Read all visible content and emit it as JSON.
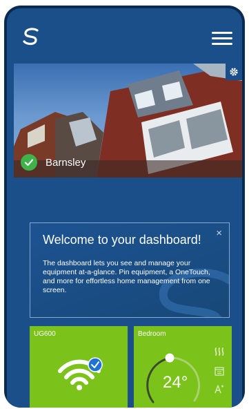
{
  "hero": {
    "location_name": "Barnsley"
  },
  "welcome": {
    "title": "Welcome to your dashboard!",
    "close": "×",
    "body": "The dashboard lets you see and manage your equipment at-a-glance. Pin equipment, a OneTouch, and more for effortless home management from one screen."
  },
  "tiles": [
    {
      "title": "UG600",
      "icon": "wifi-icon",
      "connected": true
    },
    {
      "title": "Bedroom",
      "temperature": "24°",
      "icons": [
        "heat-icon",
        "schedule-icon",
        "temperature-boost-icon"
      ]
    }
  ],
  "colors": {
    "background": "#1b4f8a",
    "frame": "#0b2a52",
    "tile_green": "#7bc21b",
    "check_green": "#3fb24a",
    "accent_blue": "#1e73d6"
  }
}
